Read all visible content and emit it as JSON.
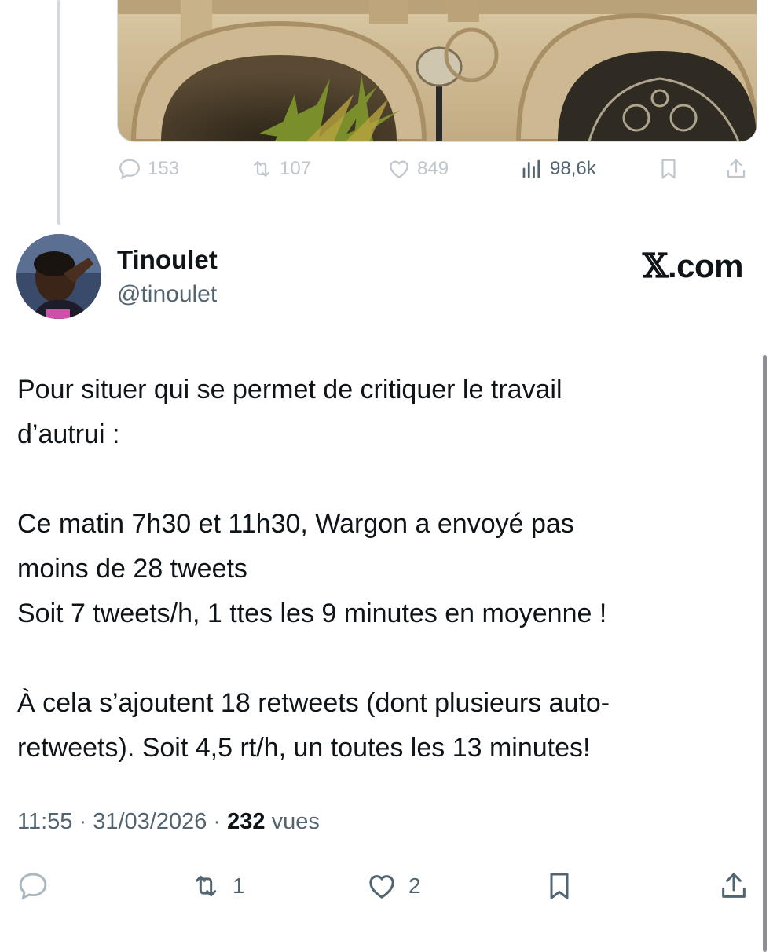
{
  "quoted_tweet": {
    "stats": {
      "replies": "153",
      "retweets": "107",
      "likes": "849",
      "views": "98,6k"
    }
  },
  "tweet": {
    "author_name": "Tinoulet",
    "author_handle": "@tinoulet",
    "source_label": "X.com",
    "text": {
      "p1_line1": "Pour situer qui se permet de critiquer le travail",
      "p1_line2": "d’autrui :",
      "p2_line1": "Ce matin 7h30 et 11h30, Wargon a envoyé pas",
      "p2_line2": "moins de 28 tweets",
      "p2_line3": "Soit 7 tweets/h, 1 ttes les 9 minutes en moyenne !",
      "p3_line1": "À cela s’ajoutent 18 retweets (dont plusieurs auto-",
      "p3_line2": "retweets). Soit 4,5 rt/h, un toutes les 13 minutes!"
    },
    "time": "11:55",
    "date": "31/03/2026",
    "views_count": "232",
    "views_label": "vues",
    "retweet_count": "1",
    "like_count": "2"
  },
  "icons": {
    "reply": "reply-icon",
    "retweet": "retweet-icon",
    "like": "like-icon",
    "views": "views-icon",
    "bookmark": "bookmark-icon",
    "share": "share-icon"
  },
  "colors": {
    "text_primary": "#0f1419",
    "text_secondary": "#536471",
    "thread_line": "#cfd9de"
  }
}
